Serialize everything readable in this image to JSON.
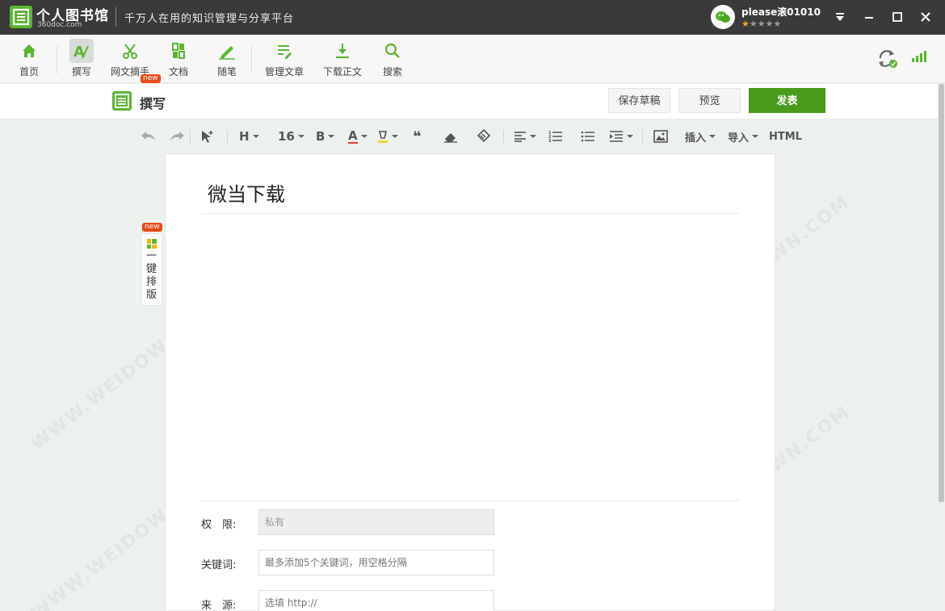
{
  "titlebar": {
    "app_name": "个人图书馆",
    "app_domain": "360doc.com",
    "slogan": "千万人在用的知识管理与分享平台",
    "username": "please滚01010",
    "rating_filled": 1,
    "rating_total": 5
  },
  "toolbar": {
    "items": [
      {
        "label": "首页",
        "icon": "home-icon"
      },
      {
        "label": "撰写",
        "icon": "write-icon"
      },
      {
        "label": "网文摘手",
        "icon": "scissors-icon",
        "badge": "new"
      },
      {
        "label": "文档",
        "icon": "document-icon"
      },
      {
        "label": "随笔",
        "icon": "pen-icon"
      },
      {
        "label": "管理文章",
        "icon": "manage-articles-icon"
      },
      {
        "label": "下载正文",
        "icon": "download-icon"
      },
      {
        "label": "搜索",
        "icon": "search-icon"
      }
    ]
  },
  "write_header": {
    "title": "撰写",
    "save_draft": "保存草稿",
    "preview": "预览",
    "publish": "发表"
  },
  "format_bar": {
    "font_size": "16",
    "insert": "插入",
    "import": "导入",
    "html": "HTML"
  },
  "side_tab": {
    "badge": "new",
    "label": "一键排版"
  },
  "document": {
    "title": "微当下载"
  },
  "form": {
    "permission_label": "权　限:",
    "permission_value": "私有",
    "keywords_label": "关键词:",
    "keywords_placeholder": "最多添加5个关键词，用空格分隔",
    "source_label": "来　源:",
    "source_placeholder": "选填 http://"
  },
  "watermark": "WWW.WEIDOWN.COM",
  "colors": {
    "brand_green": "#5cb531",
    "publish_green": "#4a9a1c",
    "titlebar_bg": "#3a3a3a",
    "badge_red": "#e64a19"
  }
}
